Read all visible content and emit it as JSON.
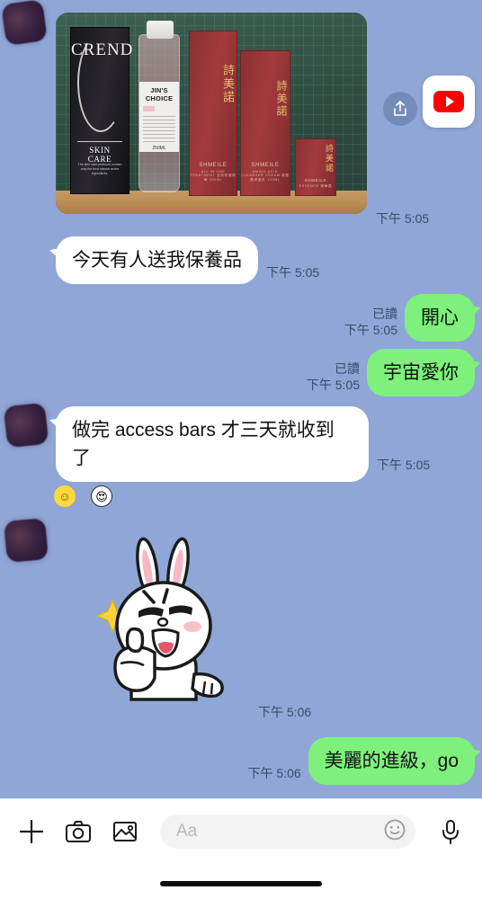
{
  "app": "LINE",
  "conversation": {
    "messages": [
      {
        "id": "m1",
        "type": "image",
        "side": "incoming",
        "time": "下午 5:05",
        "photo": {
          "alt": "skincare-products-photo",
          "black_box": {
            "brand": "CREND",
            "subtitle": "SKIN CARE",
            "fine_print": "The skin care products contain only the best natural active ingredients."
          },
          "bottle": {
            "label_title": "JIN'S CHOICE",
            "volume": "250ML"
          },
          "red_boxes": [
            {
              "cn": "詩美諾",
              "en": "SHMEILE",
              "desc": "ALL IN ONE TREATMENT 全效修護精華 250ML"
            },
            {
              "cn": "詩美諾",
              "en": "SHMEILE",
              "desc": "AMINO ACID CLEANSER CREAM 胺基酸潔面乳 120ML"
            },
            {
              "cn": "詩美諾",
              "en": "SHMEILE",
              "desc": "ESSENCE 精華霜"
            }
          ]
        },
        "overlay": {
          "share_icon": "share-upload-icon",
          "app_icon": "youtube-icon"
        }
      },
      {
        "id": "m2",
        "type": "text",
        "side": "incoming",
        "text": "今天有人送我保養品",
        "time": "下午 5:05"
      },
      {
        "id": "m3",
        "type": "text",
        "side": "outgoing",
        "text": "開心",
        "time": "下午 5:05",
        "read": "已讀"
      },
      {
        "id": "m4",
        "type": "text",
        "side": "outgoing",
        "text": "宇宙愛你",
        "time": "下午 5:05",
        "read": "已讀"
      },
      {
        "id": "m5",
        "type": "text",
        "side": "incoming",
        "text": "做完 access bars 才三天就收到了",
        "time": "下午 5:05",
        "reactions": [
          {
            "name": "smiley-reaction",
            "glyph": "☺"
          },
          {
            "name": "heart-eyes-reaction",
            "glyph": "😍"
          }
        ]
      },
      {
        "id": "m6",
        "type": "sticker",
        "side": "incoming",
        "sticker_name": "cony-rabbit-thumbs-up-sticker",
        "time": "下午 5:06"
      },
      {
        "id": "m7",
        "type": "text",
        "side": "outgoing",
        "text": "美麗的進級，go",
        "time": "下午 5:06"
      }
    ]
  },
  "composer": {
    "placeholder": "Aa",
    "icons": {
      "plus": "plus-icon",
      "camera": "camera-icon",
      "gallery": "image-icon",
      "emoji": "smiley-face-icon",
      "mic": "microphone-icon"
    }
  },
  "colors": {
    "chat_background": "#8fa6d6",
    "outgoing_bubble": "#7ef07c",
    "incoming_bubble": "#ffffff",
    "timestamp_text": "#374b6b",
    "youtube_red": "#ff0000"
  }
}
